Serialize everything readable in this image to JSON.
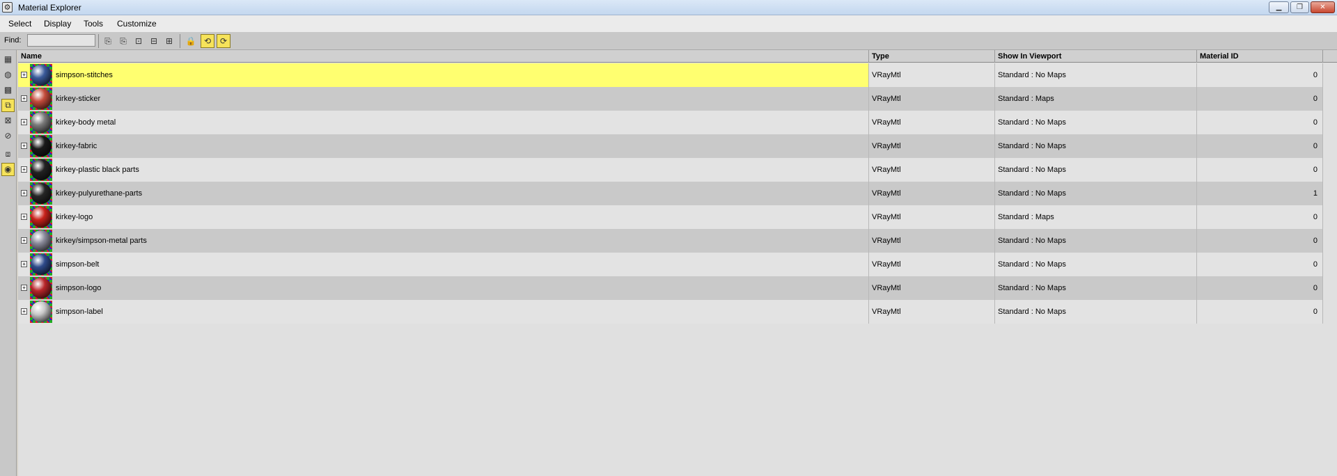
{
  "window": {
    "title": "Material Explorer"
  },
  "menu": [
    "Select",
    "Display",
    "Tools",
    "Customize"
  ],
  "toolbar": {
    "find_label": "Find:",
    "find_value": ""
  },
  "columns": [
    "Name",
    "Type",
    "Show In Viewport",
    "Material ID"
  ],
  "rows": [
    {
      "name": "simpson-stitches",
      "type": "VRayMtl",
      "viewport": "Standard : No Maps",
      "id": "0",
      "selected": true,
      "sphere": "#3a5a9a"
    },
    {
      "name": "kirkey-sticker",
      "type": "VRayMtl",
      "viewport": "Standard : Maps",
      "id": "0",
      "selected": false,
      "sphere": "#c44c3c"
    },
    {
      "name": "kirkey-body metal",
      "type": "VRayMtl",
      "viewport": "Standard : No Maps",
      "id": "0",
      "selected": false,
      "sphere": "#7a7a7a"
    },
    {
      "name": "kirkey-fabric",
      "type": "VRayMtl",
      "viewport": "Standard : No Maps",
      "id": "0",
      "selected": false,
      "sphere": "#1a1a1a"
    },
    {
      "name": "kirkey-plastic black parts",
      "type": "VRayMtl",
      "viewport": "Standard : No Maps",
      "id": "0",
      "selected": false,
      "sphere": "#222222"
    },
    {
      "name": "kirkey-pulyurethane-parts",
      "type": "VRayMtl",
      "viewport": "Standard : No Maps",
      "id": "1",
      "selected": false,
      "sphere": "#262626"
    },
    {
      "name": "kirkey-logo",
      "type": "VRayMtl",
      "viewport": "Standard : Maps",
      "id": "0",
      "selected": false,
      "sphere": "#c8221a"
    },
    {
      "name": "kirkey/simpson-metal parts",
      "type": "VRayMtl",
      "viewport": "Standard : No Maps",
      "id": "0",
      "selected": false,
      "sphere": "#8a8a9a"
    },
    {
      "name": "simpson-belt",
      "type": "VRayMtl",
      "viewport": "Standard : No Maps",
      "id": "0",
      "selected": false,
      "sphere": "#2e4a8a"
    },
    {
      "name": "simpson-logo",
      "type": "VRayMtl",
      "viewport": "Standard : No Maps",
      "id": "0",
      "selected": false,
      "sphere": "#b8262a"
    },
    {
      "name": "simpson-label",
      "type": "VRayMtl",
      "viewport": "Standard : No Maps",
      "id": "0",
      "selected": false,
      "sphere": "#c8c8c8"
    }
  ]
}
